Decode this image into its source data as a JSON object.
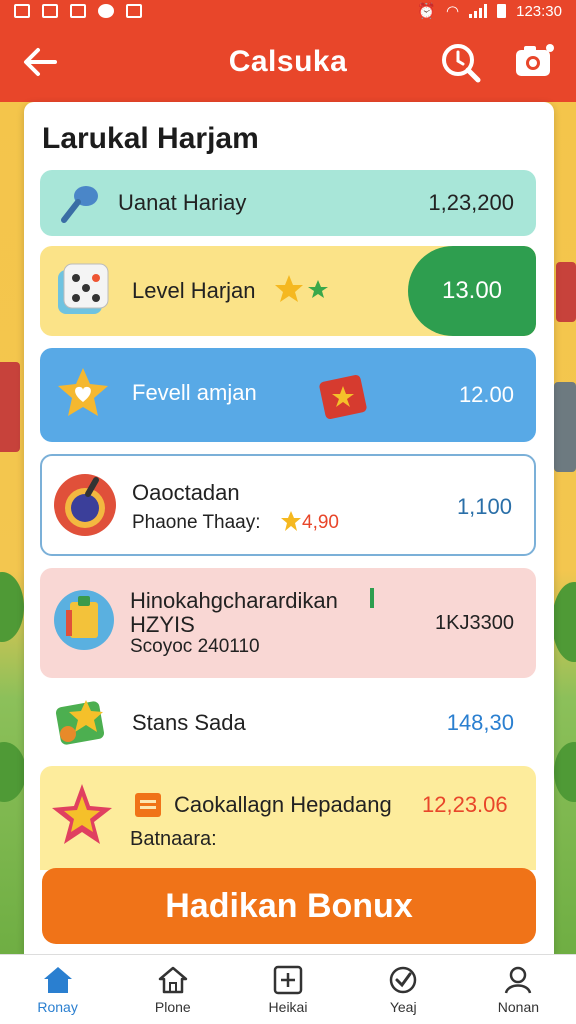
{
  "status_bar": {
    "time": "123:30"
  },
  "app_bar": {
    "title": "Calsuka"
  },
  "card": {
    "title": "Larukal Harjam"
  },
  "rows": [
    {
      "label": "Uanat Hariay",
      "value": "1,23,200"
    },
    {
      "label": "Level Harjan",
      "value": "13.00"
    },
    {
      "label": "Fevell amjan",
      "value": "12.00"
    },
    {
      "label": "Oaoctadan",
      "sublabel": "Phaone Thaay:",
      "sub_value": "4,90",
      "value": "1,100"
    },
    {
      "label": "Hinokahgcharardikan",
      "label2": "HZYIS",
      "sublabel": "Scoyoc 240110",
      "value": "1KJ3300"
    },
    {
      "label": "Stans Sada",
      "value": "148,30"
    },
    {
      "label": "Caokallagn Hepadang",
      "value": "12,23.06",
      "sublabel": "Batnaara:"
    }
  ],
  "bonus_button": {
    "label": "Hadikan Bonux"
  },
  "nav": [
    {
      "label": "Ronay",
      "icon": "home-filled-icon",
      "active": true
    },
    {
      "label": "Plone",
      "icon": "home-outline-icon",
      "active": false
    },
    {
      "label": "Heikai",
      "icon": "plus-square-icon",
      "active": false
    },
    {
      "label": "Yeaj",
      "icon": "check-circle-icon",
      "active": false
    },
    {
      "label": "Nonan",
      "icon": "person-icon",
      "active": false
    }
  ],
  "colors": {
    "accent": "#e8462a",
    "button": "#f07318",
    "active_nav": "#2a7fd0",
    "green_pill": "#2e9e4f"
  }
}
